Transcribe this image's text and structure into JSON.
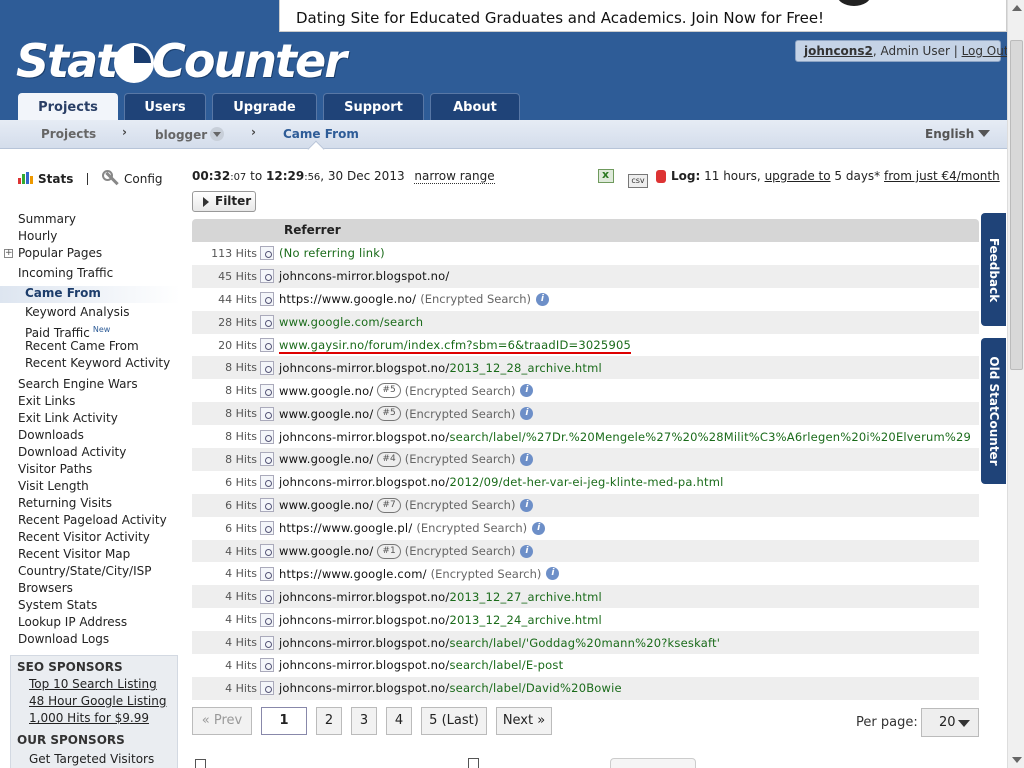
{
  "ad": {
    "text": "Dating Site for Educated Graduates and Academics. Join Now for Free!"
  },
  "logo": {
    "text_left": "Stat",
    "text_right": "Counter"
  },
  "user": {
    "username": "johncons2",
    "role": ", Admin User",
    "logout": "Log Out"
  },
  "tabs": [
    "Projects",
    "Users",
    "Upgrade",
    "Support",
    "About"
  ],
  "breadcrumb": {
    "projects": "Projects",
    "project": "blogger",
    "current": "Came From",
    "language": "English"
  },
  "sidebar": {
    "stats": "Stats",
    "config": "Config",
    "items": [
      "Summary",
      "Hourly",
      "Popular Pages",
      "Incoming Traffic",
      "Came From",
      "Keyword Analysis",
      "Paid Traffic",
      "Recent Came From",
      "Recent Keyword Activity",
      "Search Engine Wars",
      "Exit Links",
      "Exit Link Activity",
      "Downloads",
      "Download Activity",
      "Visitor Paths",
      "Visit Length",
      "Returning Visits",
      "Recent Pageload Activity",
      "Recent Visitor Activity",
      "Recent Visitor Map",
      "Country/State/City/ISP",
      "Browsers",
      "System Stats",
      "Lookup IP Address",
      "Download Logs"
    ],
    "new_badge": "New",
    "seo_title": "SEO SPONSORS",
    "seo_links": [
      "Top 10 Search Listing",
      "48 Hour Google Listing",
      "1,000 Hits for $9.99"
    ],
    "our_title": "OUR SPONSORS",
    "our_links": [
      "Get Targeted Visitors"
    ]
  },
  "toolbar": {
    "from_time": "00:32",
    "from_sec": ":07",
    "to": "to",
    "to_time": "12:29",
    "to_sec": ":56",
    "date": ", 30 Dec 2013",
    "narrow": "narrow range",
    "csv": "csv",
    "log_label": "Log:",
    "log_hours": "11 hours,",
    "upgrade_to": "upgrade to",
    "days": "5 days*",
    "from_just": "from just €4/month",
    "filter": "Filter"
  },
  "table": {
    "header": "Referrer",
    "rows": [
      {
        "hits": "113 Hits",
        "ref": "(No referring link)",
        "green": true
      },
      {
        "hits": "45 Hits",
        "dom": "johncons-mirror.blogspot.no/",
        "path": ""
      },
      {
        "hits": "44 Hits",
        "dom": "https://www.google.no/",
        "path": "",
        "enc": "(Encrypted Search)",
        "info": true
      },
      {
        "hits": "28 Hits",
        "dom": "www.google.com/search",
        "path": "",
        "greenall": true
      },
      {
        "hits": "20 Hits",
        "dom": "www.gaysir.no/forum/index.cfm?sbm=6&traadID=3025905",
        "path": "",
        "highlight": true
      },
      {
        "hits": "8 Hits",
        "dom": "johncons-mirror.blogspot.no/",
        "path": "2013_12_28_archive.html"
      },
      {
        "hits": "8 Hits",
        "dom": "www.google.no/",
        "badge": "#5",
        "enc": "(Encrypted Search)",
        "info": true
      },
      {
        "hits": "8 Hits",
        "dom": "www.google.no/",
        "badge": "#5",
        "enc": "(Encrypted Search)",
        "info": true
      },
      {
        "hits": "8 Hits",
        "dom": "johncons-mirror.blogspot.no/",
        "path": "search/label/%27Dr.%20Mengele%27%20%28Milit%C3%A6rlegen%20i%20Elverum%29"
      },
      {
        "hits": "8 Hits",
        "dom": "www.google.no/",
        "badge": "#4",
        "enc": "(Encrypted Search)",
        "info": true
      },
      {
        "hits": "6 Hits",
        "dom": "johncons-mirror.blogspot.no/",
        "path": "2012/09/det-her-var-ei-jeg-klinte-med-pa.html"
      },
      {
        "hits": "6 Hits",
        "dom": "www.google.no/",
        "badge": "#7",
        "enc": "(Encrypted Search)",
        "info": true
      },
      {
        "hits": "6 Hits",
        "dom": "https://www.google.pl/",
        "enc": "(Encrypted Search)",
        "info": true
      },
      {
        "hits": "4 Hits",
        "dom": "www.google.no/",
        "badge": "#1",
        "enc": "(Encrypted Search)",
        "info": true
      },
      {
        "hits": "4 Hits",
        "dom": "https://www.google.com/",
        "enc": "(Encrypted Search)",
        "info": true
      },
      {
        "hits": "4 Hits",
        "dom": "johncons-mirror.blogspot.no/",
        "path": "2013_12_27_archive.html"
      },
      {
        "hits": "4 Hits",
        "dom": "johncons-mirror.blogspot.no/",
        "path": "2013_12_24_archive.html"
      },
      {
        "hits": "4 Hits",
        "dom": "johncons-mirror.blogspot.no/",
        "path": "search/label/'Goddag%20mann%20?kseskaft'"
      },
      {
        "hits": "4 Hits",
        "dom": "johncons-mirror.blogspot.no/",
        "path": "search/label/E-post"
      },
      {
        "hits": "4 Hits",
        "dom": "johncons-mirror.blogspot.no/",
        "path": "search/label/David%20Bowie"
      }
    ]
  },
  "pager": {
    "prev": "« Prev",
    "pages": [
      "1",
      "2",
      "3",
      "4",
      "5 (Last)"
    ],
    "next": "Next »",
    "per_page_label": "Per page:",
    "per_page_value": "20"
  },
  "side_tabs": {
    "feedback": "Feedback",
    "old": "Old StatCounter"
  },
  "colors": {
    "header_blue": "#2e5c97",
    "tab_dark": "#1f4378",
    "link_green": "#1a6b1a",
    "highlight_red": "#dd0000"
  }
}
